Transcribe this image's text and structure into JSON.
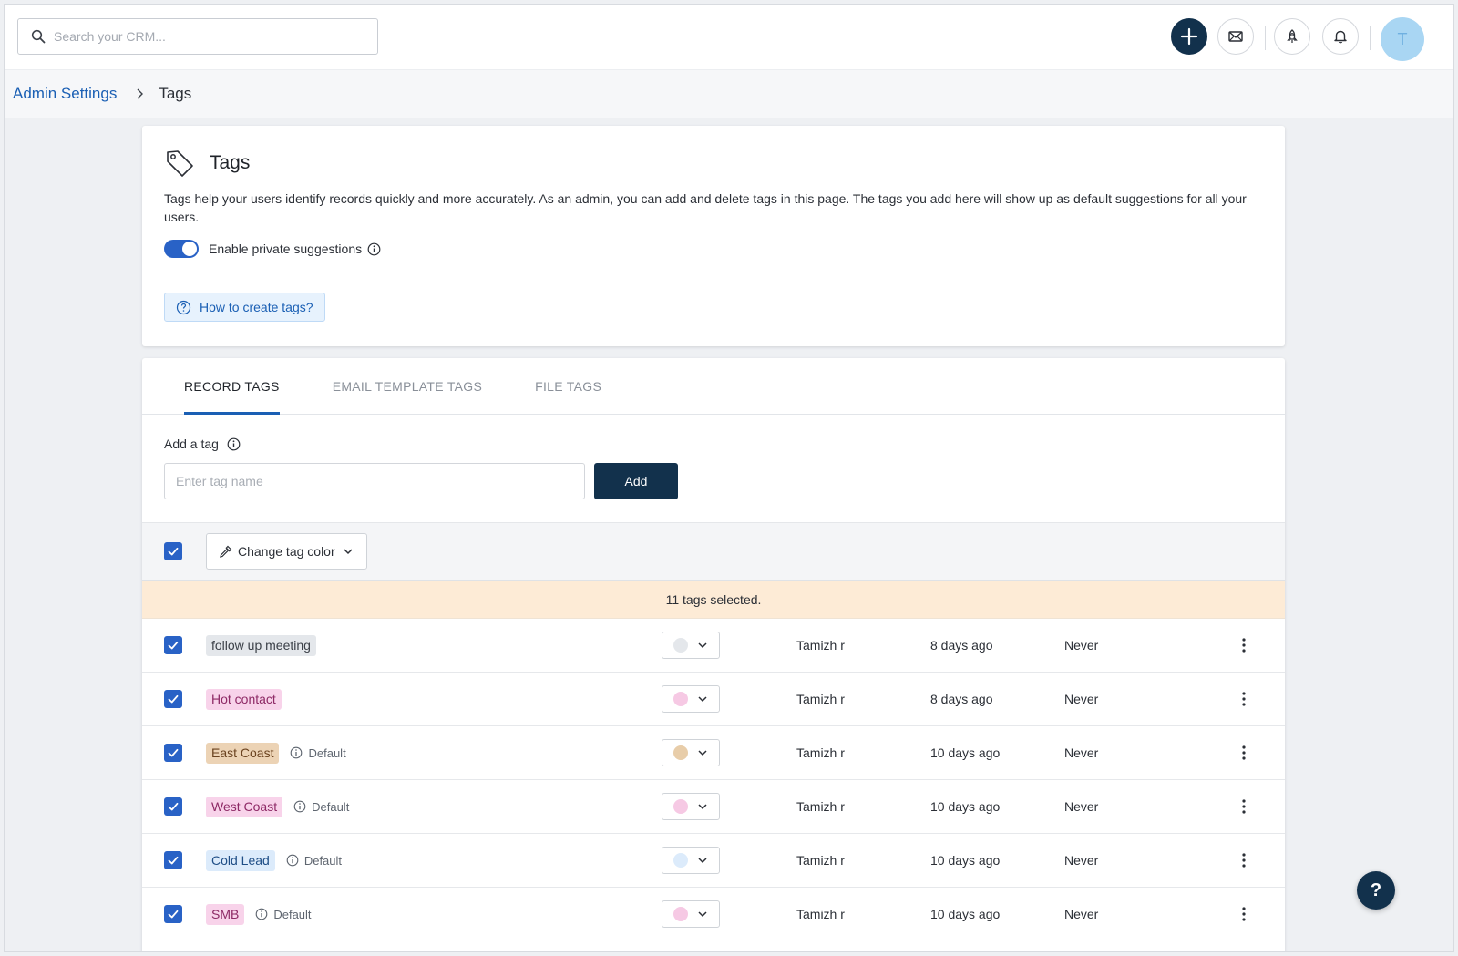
{
  "header": {
    "search_placeholder": "Search your CRM...",
    "avatar_initial": "T"
  },
  "breadcrumb": {
    "parent": "Admin Settings",
    "current": "Tags"
  },
  "info": {
    "title": "Tags",
    "description": "Tags help your users identify records quickly and more accurately. As an admin, you can add and delete tags in this page. The tags you add here will show up as default suggestions for all your users.",
    "toggle_label": "Enable private suggestions",
    "toggle_on": true,
    "help_link": "How to create tags?"
  },
  "tabs": [
    {
      "label": "RECORD TAGS",
      "active": true
    },
    {
      "label": "EMAIL TEMPLATE TAGS",
      "active": false
    },
    {
      "label": "FILE TAGS",
      "active": false
    }
  ],
  "add_tag": {
    "label": "Add a tag",
    "placeholder": "Enter tag name",
    "button": "Add"
  },
  "toolbar": {
    "change_color_label": "Change tag color"
  },
  "selection_banner": "11 tags selected.",
  "rows": [
    {
      "tag": "follow up meeting",
      "default": "",
      "pill_bg": "#e4e7eb",
      "pill_fg": "#3b4048",
      "swatch": "#e4e7eb",
      "owner": "Tamizh r",
      "created": "8 days ago",
      "last_used": "Never"
    },
    {
      "tag": "Hot contact",
      "default": "",
      "pill_bg": "#f8d3ea",
      "pill_fg": "#8e2a66",
      "swatch": "#f6c9e4",
      "owner": "Tamizh r",
      "created": "8 days ago",
      "last_used": "Never"
    },
    {
      "tag": "East Coast",
      "default": "Default",
      "pill_bg": "#ecd3b5",
      "pill_fg": "#6b4320",
      "swatch": "#e8cda9",
      "owner": "Tamizh r",
      "created": "10 days ago",
      "last_used": "Never"
    },
    {
      "tag": "West Coast",
      "default": "Default",
      "pill_bg": "#f8d3ea",
      "pill_fg": "#8e2a66",
      "swatch": "#f6c9e4",
      "owner": "Tamizh r",
      "created": "10 days ago",
      "last_used": "Never"
    },
    {
      "tag": "Cold Lead",
      "default": "Default",
      "pill_bg": "#dcebfb",
      "pill_fg": "#1f4e86",
      "swatch": "#dcebfb",
      "owner": "Tamizh r",
      "created": "10 days ago",
      "last_used": "Never"
    },
    {
      "tag": "SMB",
      "default": "Default",
      "pill_bg": "#f8d3ea",
      "pill_fg": "#8e2a66",
      "swatch": "#f6c9e4",
      "owner": "Tamizh r",
      "created": "10 days ago",
      "last_used": "Never"
    }
  ],
  "help_fab": "?",
  "colors": {
    "brand_dark": "#12314c",
    "link_blue": "#1a5fb4",
    "checkbox_blue": "#2962c6",
    "banner_bg": "#fdebd6"
  }
}
